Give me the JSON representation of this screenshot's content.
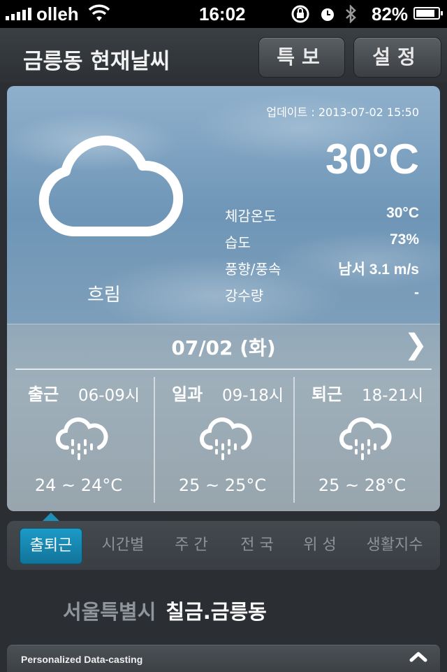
{
  "status_bar": {
    "carrier": "olleh",
    "time": "16:02",
    "battery": "82%",
    "battery_level": 0.82
  },
  "header": {
    "title": "금릉동 현재날씨",
    "alert_button": "특보",
    "settings_button": "설정"
  },
  "current": {
    "updated": "업데이트 : 2013-07-02 15:50",
    "temperature": "30°C",
    "condition": "흐림",
    "condition_icon": "cloud-icon",
    "details": [
      {
        "label": "체감온도",
        "value": "30°C"
      },
      {
        "label": "습도",
        "value": "73%"
      },
      {
        "label": "풍향/풍속",
        "value": "남서 3.1 m/s"
      },
      {
        "label": "강수량",
        "value": "-"
      }
    ]
  },
  "forecast": {
    "date": "07/02 (화)",
    "next_icon": "chevron-right-icon",
    "periods": [
      {
        "name": "출근",
        "hours": "06-09시",
        "range": "24 ~ 24°C",
        "icon": "rain-cloud-icon"
      },
      {
        "name": "일과",
        "hours": "09-18시",
        "range": "25 ~ 25°C",
        "icon": "rain-cloud-icon"
      },
      {
        "name": "퇴근",
        "hours": "18-21시",
        "range": "25 ~ 28°C",
        "icon": "rain-cloud-icon"
      }
    ]
  },
  "tabs": [
    {
      "label": "출퇴근",
      "active": true
    },
    {
      "label": "시간별",
      "active": false
    },
    {
      "label": "주 간",
      "active": false
    },
    {
      "label": "전 국",
      "active": false
    },
    {
      "label": "위 성",
      "active": false
    },
    {
      "label": "생활지수",
      "active": false
    }
  ],
  "location": {
    "city": "서울특별시",
    "district": "칠금.금릉동"
  },
  "data_bar": {
    "label": "Personalized Data-casting",
    "toggle_icon": "chevron-up-icon"
  },
  "colors": {
    "accent": "#1c9ac6",
    "background": "#2b2f33"
  }
}
